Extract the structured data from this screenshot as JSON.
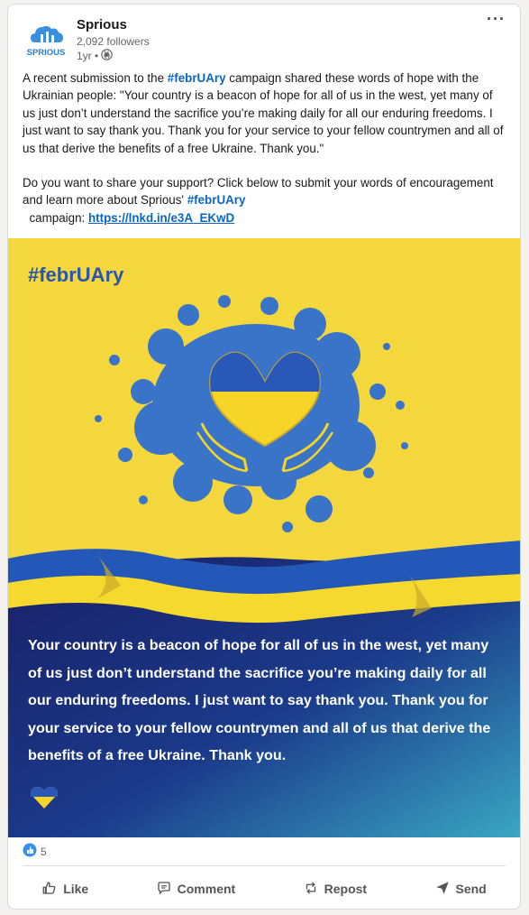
{
  "post": {
    "company": "Sprious",
    "followers": "2,092 followers",
    "time": "1yr •",
    "logo_text": "SPRIOUS",
    "body": {
      "p1_a": "A recent submission to the ",
      "p1_tag": "#febrUAry",
      "p1_b": " campaign shared these words of hope with the Ukrainian people: \"Your country is a beacon of hope for all of us in the west, yet many of us just don’t understand the sacrifice you’re making daily for all our enduring freedoms. I just want to say thank you. Thank you for your service to your fellow countrymen and all of us that derive the benefits of a free Ukraine. Thank you.\"",
      "p2_a": "Do you want to share your support? Click below to submit your words of encouragement and learn more about Sprious' ",
      "p2_tag": "#febrUAry",
      "p2_b": " campaign: ",
      "link": "https://lnkd.in/e3A_EKwD"
    },
    "image": {
      "tag_prefix": "#febr",
      "tag_ua": "UA",
      "tag_suffix": "ry",
      "quote": "Your country is a beacon of hope for all of us in the west, yet many of us just don’t understand the sacrifice you’re making daily for all our enduring freedoms. I just want to say thank you. Thank you for your service to your fellow countrymen and all of us that derive the benefits of a free Ukraine. Thank you.",
      "colors": {
        "yellow": "#f7d83a",
        "blue": "#2f5fb8",
        "navy": "#1a2670",
        "teal": "#3ba7c0"
      }
    },
    "reactions": {
      "count": "5",
      "icon": "like-reaction-icon"
    },
    "actions": {
      "like": "Like",
      "comment": "Comment",
      "repost": "Repost",
      "send": "Send"
    }
  }
}
